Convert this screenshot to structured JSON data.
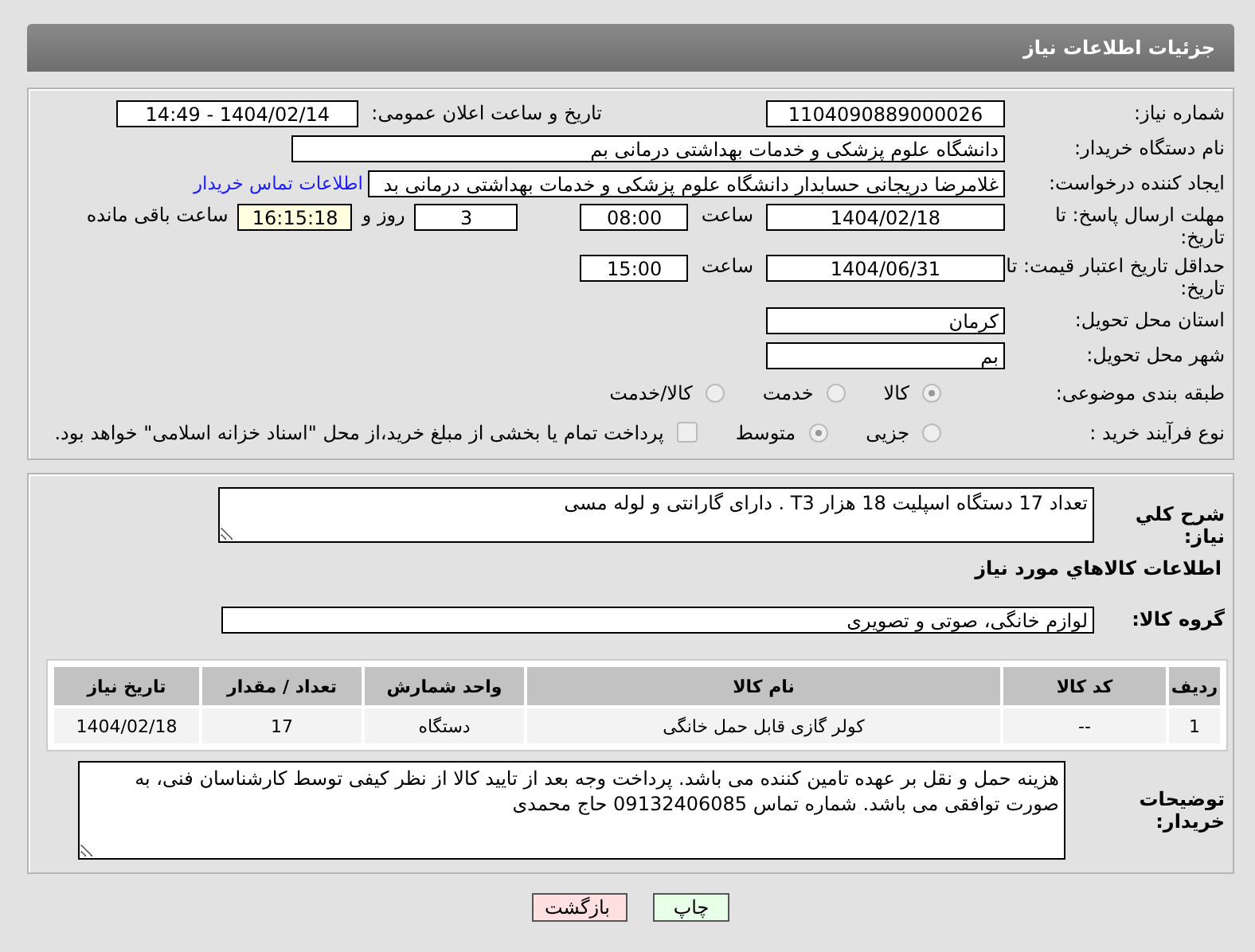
{
  "header": {
    "title": "جزئیات اطلاعات نیاز"
  },
  "need_number": {
    "label": "شماره نیاز:",
    "value": "1104090889000026"
  },
  "announce": {
    "label": "تاریخ و ساعت اعلان عمومی:",
    "value": "1404/02/14 - 14:49"
  },
  "buyer_org": {
    "label": "نام دستگاه خریدار:",
    "value": "دانشگاه علوم پزشکی و خدمات بهداشتی  درمانی بم"
  },
  "requester": {
    "label": "ایجاد کننده درخواست:",
    "value": "غلامرضا دریجانی حسابدار دانشگاه علوم پزشکی و خدمات بهداشتی  درمانی بد",
    "link": "اطلاعات تماس خریدار"
  },
  "reply_deadline": {
    "label": "مهلت ارسال پاسخ: تا تاریخ:",
    "date": "1404/02/18",
    "time_label": "ساعت",
    "time": "08:00",
    "days": "3",
    "days_label": "روز و",
    "remaining": "16:15:18",
    "remaining_label": "ساعت باقی مانده"
  },
  "price_validity": {
    "label": "حداقل تاریخ اعتبار قیمت: تا تاریخ:",
    "date": "1404/06/31",
    "time_label": "ساعت",
    "time": "15:00"
  },
  "province": {
    "label": "استان محل تحویل:",
    "value": "کرمان"
  },
  "city": {
    "label": "شهر محل تحویل:",
    "value": "بم"
  },
  "category": {
    "label": "طبقه بندی موضوعی:",
    "options": [
      {
        "label": "کالا",
        "selected": true
      },
      {
        "label": "خدمت",
        "selected": false
      },
      {
        "label": "کالا/خدمت",
        "selected": false
      }
    ]
  },
  "process": {
    "label": "نوع فرآیند خرید :",
    "options": [
      {
        "label": "جزیی",
        "selected": false
      },
      {
        "label": "متوسط",
        "selected": true
      }
    ],
    "payment_option": {
      "label": "پرداخت تمام یا بخشی از مبلغ خرید،از محل \"اسناد خزانه اسلامی\" خواهد بود.",
      "checked": false
    }
  },
  "description": {
    "label": "شرح کلي نياز:",
    "value": "تعداد 17 دستگاه اسپلیت 18 هزار T3 . دارای گارانتی و لوله مسی"
  },
  "goods_heading": "اطلاعات کالاهاي مورد نياز",
  "goods_group": {
    "label": "گروه کالا:",
    "value": "لوازم خانگی، صوتی و تصویری"
  },
  "table": {
    "columns": [
      "ردیف",
      "کد کالا",
      "نام کالا",
      "واحد شمارش",
      "تعداد / مقدار",
      "تاریخ نیاز"
    ],
    "rows": [
      [
        "1",
        "--",
        "کولر گازی قابل حمل خانگی",
        "دستگاه",
        "17",
        "1404/02/18"
      ]
    ]
  },
  "buyer_notes": {
    "label": "توضیحات خریدار:",
    "value": "هزینه حمل و نقل بر عهده تامین کننده می باشد. پرداخت وجه بعد از تایید کالا از نظر کیفی توسط کارشناسان فنی، به صورت توافقی می باشد. شماره تماس 09132406085 حاج محمدی"
  },
  "buttons": [
    {
      "label": "چاپ",
      "kind": "print"
    },
    {
      "label": "بازگشت",
      "kind": "back"
    }
  ]
}
